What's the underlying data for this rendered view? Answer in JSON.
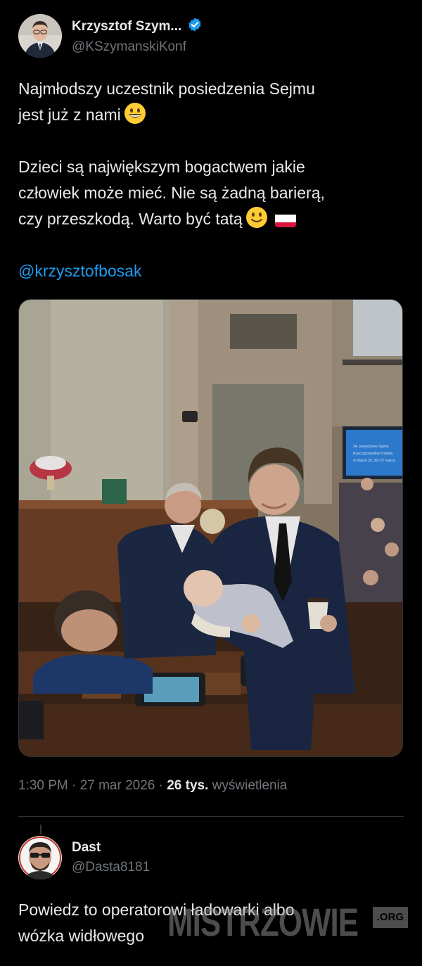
{
  "tweet": {
    "author_name": "Krzysztof Szym...",
    "author_handle": "@KSzymanskiKonf",
    "line1": "Najmłodszy uczestnik posiedzenia Sejmu",
    "line2": "jest już z nami",
    "line3": "Dzieci są największym bogactwem jakie",
    "line4": "człowiek może mieć. Nie są żadną barierą,",
    "line5": "czy przeszkodą. Warto być tatą",
    "mention": "@krzysztofbosak",
    "time": "1:30 PM",
    "date": "27 mar 2026",
    "views_count": "26 tys.",
    "views_label": "wyświetlenia",
    "sep": "·",
    "screen_line1": "34. posiedzenie Sejmu",
    "screen_line2": "Rzeczypospolitej Polskiej",
    "screen_line3": "w dniach 25, 26 i 27 marca"
  },
  "reply": {
    "author_name": "Dast",
    "author_handle": "@Dasta8181",
    "line1": "Powiedz to operatorowi ładowarki albo",
    "line2": "wózka widłowego"
  },
  "watermark": {
    "text": "MISTRZOWIE",
    "tld": ".ORG"
  },
  "colors": {
    "background": "#000000",
    "text": "#e7e9ea",
    "muted": "#71767b",
    "link": "#1d9bf0",
    "verified": "#1d9bf0"
  },
  "icons": [
    "verified-badge-icon",
    "grinning-face-emoji",
    "slightly-smiling-face-emoji",
    "poland-flag-emoji"
  ]
}
